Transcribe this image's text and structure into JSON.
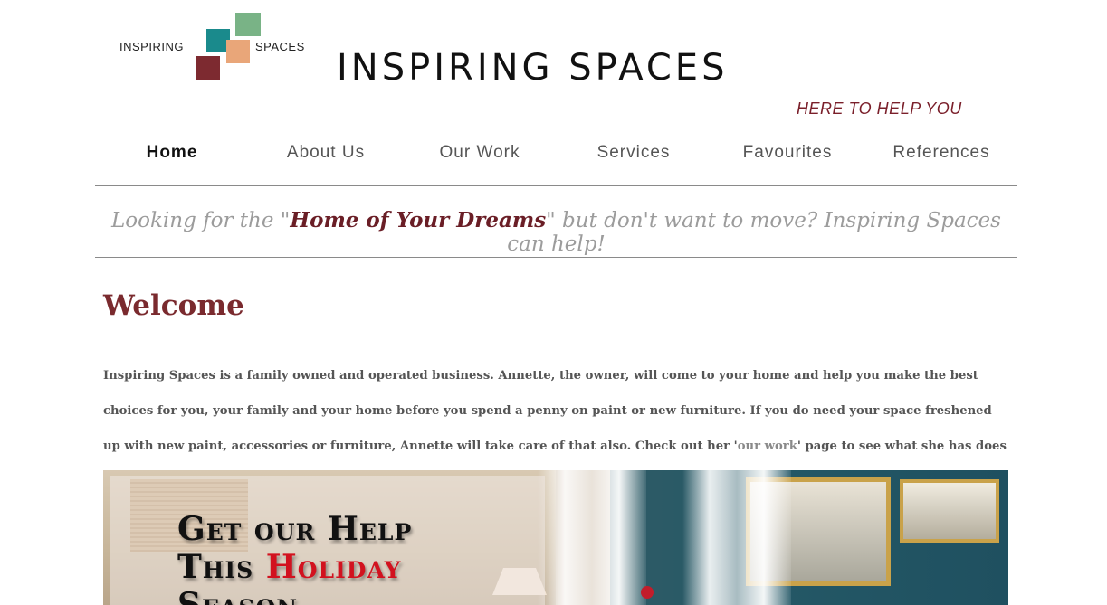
{
  "header": {
    "logo_left_text": "INSPIRING",
    "logo_right_text": "SPACES",
    "site_title": "INSPIRING SPACES",
    "tagline": "HERE TO HELP YOU"
  },
  "nav": {
    "items": [
      {
        "label": "Home",
        "active": true
      },
      {
        "label": "About Us"
      },
      {
        "label": "Our Work"
      },
      {
        "label": "Services"
      },
      {
        "label": "Favourites"
      },
      {
        "label": "References"
      }
    ]
  },
  "banner": {
    "prefix": "Looking for the \"",
    "highlight": "Home of Your Dreams",
    "suffix": "\" but don't want to move? Inspiring Spaces can help!"
  },
  "main": {
    "heading": "Welcome",
    "intro_part1": "Inspiring Spaces is a family owned and operated business. Annette, the owner, will come to your home and help you make the best choices for you, your family and your home before you spend a penny on paint or new furniture. If you do need your space freshened up with new paint, accessories or furniture, Annette will take care of that also. Check out her '",
    "intro_link": "our work",
    "intro_part2": "' page to see what she has does for other families."
  },
  "hero": {
    "line1": "Get our Help",
    "line2_a": "This ",
    "line2_b": "Holiday",
    "line3": "Season"
  },
  "colors": {
    "brand_red": "#7a2a2e",
    "teal": "#1a8a8c",
    "green": "#79b386",
    "orange": "#e9a679",
    "accent_red": "#d2121f"
  }
}
